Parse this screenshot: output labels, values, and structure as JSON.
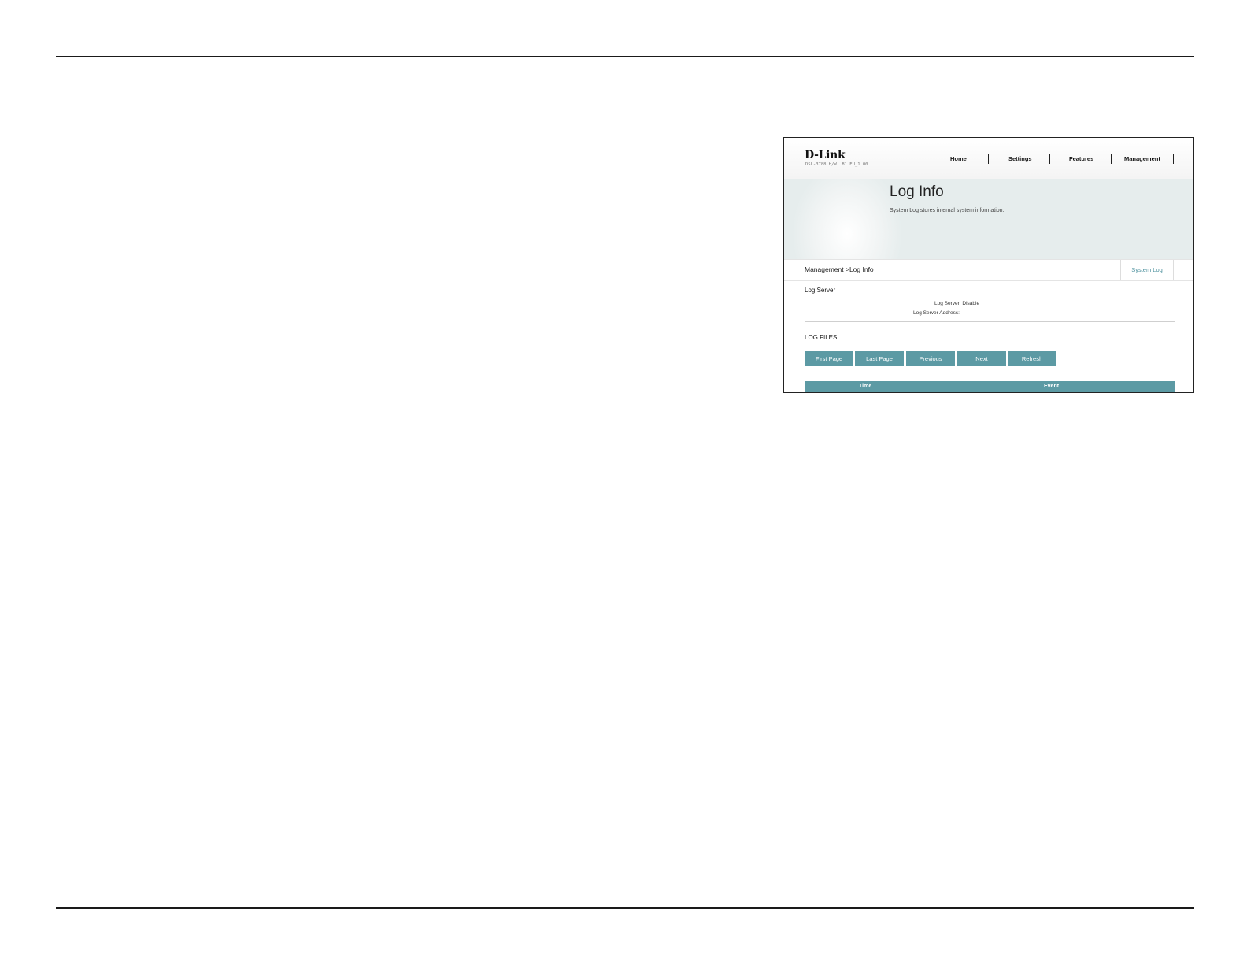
{
  "router_ui": {
    "brand": "D-Link",
    "model": "DSL-3788  H/W: B1  EU_1.00",
    "nav": [
      "Home",
      "Settings",
      "Features",
      "Management"
    ],
    "page_title": "Log Info",
    "page_subtitle": "System Log stores internal system information.",
    "breadcrumb": "Management >Log Info",
    "tab_link": "System Log",
    "log_server": {
      "title": "Log Server",
      "status": "Log Server: Disable",
      "address_label": "Log Server Address:"
    },
    "log_files": {
      "title": "LOG FILES",
      "buttons": [
        "First Page",
        "Last Page",
        "Previous",
        "Next",
        "Refresh"
      ],
      "columns": [
        "Time",
        "Event"
      ]
    }
  }
}
